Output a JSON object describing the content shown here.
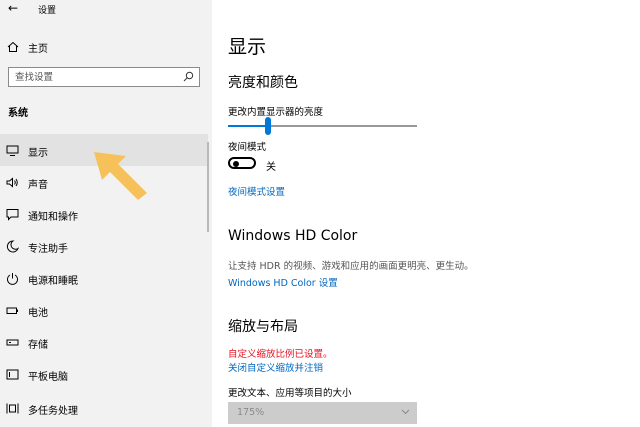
{
  "app": {
    "title": "设置"
  },
  "sidebar": {
    "home_label": "主页",
    "search_placeholder": "查找设置",
    "section_label": "系统",
    "items": [
      {
        "label": "显示",
        "icon": "monitor-icon",
        "selected": true
      },
      {
        "label": "声音",
        "icon": "speaker-icon"
      },
      {
        "label": "通知和操作",
        "icon": "notification-icon"
      },
      {
        "label": "专注助手",
        "icon": "moon-icon"
      },
      {
        "label": "电源和睡眠",
        "icon": "power-icon"
      },
      {
        "label": "电池",
        "icon": "battery-icon"
      },
      {
        "label": "存储",
        "icon": "storage-icon"
      },
      {
        "label": "平板电脑",
        "icon": "tablet-icon"
      },
      {
        "label": "多任务处理",
        "icon": "multitask-icon"
      }
    ]
  },
  "main": {
    "page_title": "显示",
    "brightness": {
      "heading": "亮度和颜色",
      "slider_label": "更改内置显示器的亮度",
      "slider_value": 0.21,
      "night_mode_label": "夜间模式",
      "night_mode_state": "关",
      "night_mode_settings_link": "夜间模式设置"
    },
    "hdr": {
      "heading": "Windows HD Color",
      "description": "让支持 HDR 的视频、游戏和应用的画面更明亮、更生动。",
      "settings_link": "Windows HD Color 设置"
    },
    "scale": {
      "heading": "缩放与布局",
      "custom_scale_notice": "自定义缩放比例已设置。",
      "sign_out_link": "关闭自定义缩放并注销",
      "size_label": "更改文本、应用等项目的大小",
      "size_value": "175%"
    }
  },
  "colors": {
    "accent": "#0078d7",
    "link": "#0067c0",
    "warning": "#e81123",
    "sidebar_bg": "#f2f2f2",
    "arrow": "#f7c15a"
  }
}
